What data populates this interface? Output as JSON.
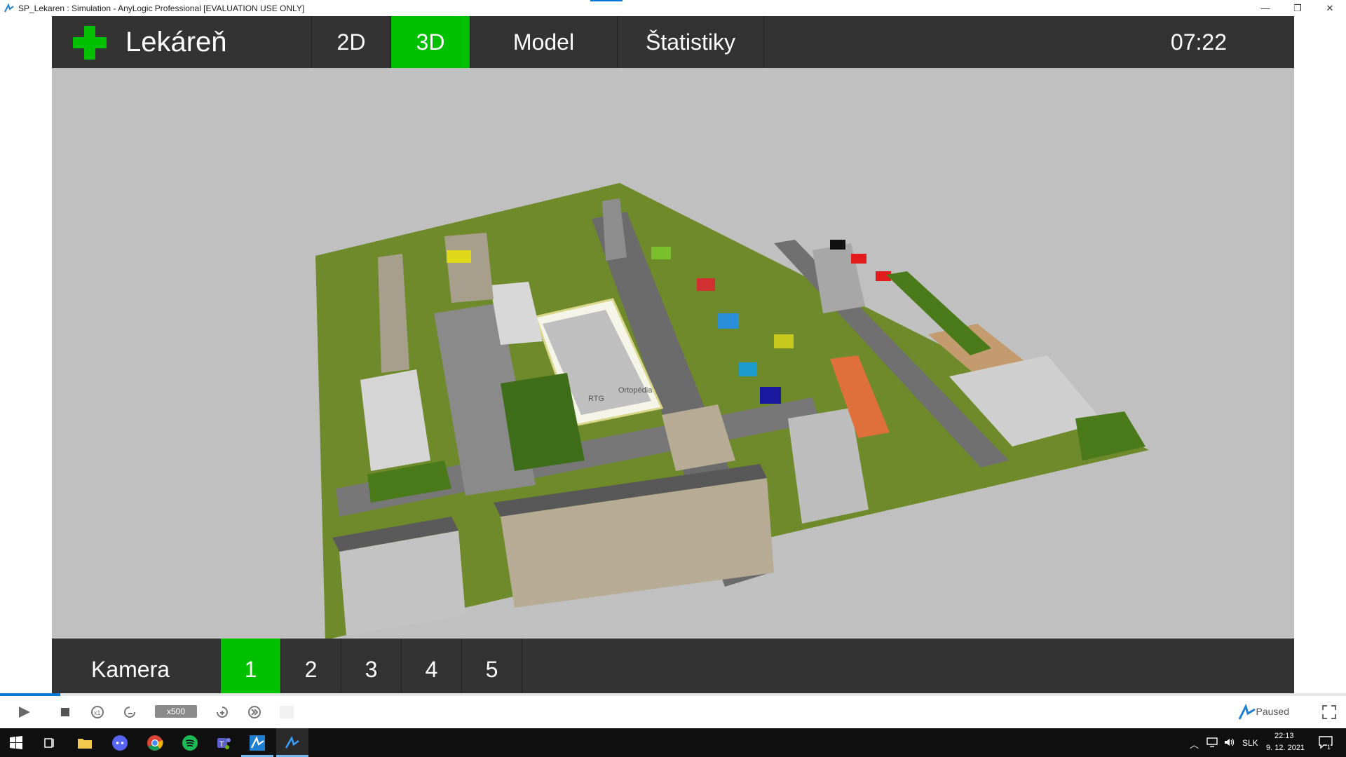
{
  "window": {
    "title": "SP_Lekaren : Simulation - AnyLogic Professional [EVALUATION USE ONLY]",
    "minimize": "—",
    "maximize": "❐",
    "close": "✕"
  },
  "header": {
    "app_title": "Lekáreň",
    "tabs": [
      {
        "label": "2D",
        "active": false
      },
      {
        "label": "3D",
        "active": true
      },
      {
        "label": "Model",
        "active": false
      },
      {
        "label": "Štatistiky",
        "active": false
      }
    ],
    "clock": "07:22"
  },
  "scene": {
    "labels": {
      "rtg": "RTG",
      "ortopedia": "Ortopédia"
    }
  },
  "camera_bar": {
    "label": "Kamera",
    "buttons": [
      {
        "label": "1",
        "active": true
      },
      {
        "label": "2",
        "active": false
      },
      {
        "label": "3",
        "active": false
      },
      {
        "label": "4",
        "active": false
      },
      {
        "label": "5",
        "active": false
      }
    ]
  },
  "sim_controls": {
    "progress": 0.045,
    "speed": "x500",
    "status": "Paused"
  },
  "taskbar": {
    "language": "SLK",
    "time": "22:13",
    "date": "9. 12. 2021",
    "notification_count": "1"
  },
  "colors": {
    "accent_green": "#00c000",
    "bar_dark": "#333333",
    "scene_bg": "#c0c0c0"
  }
}
